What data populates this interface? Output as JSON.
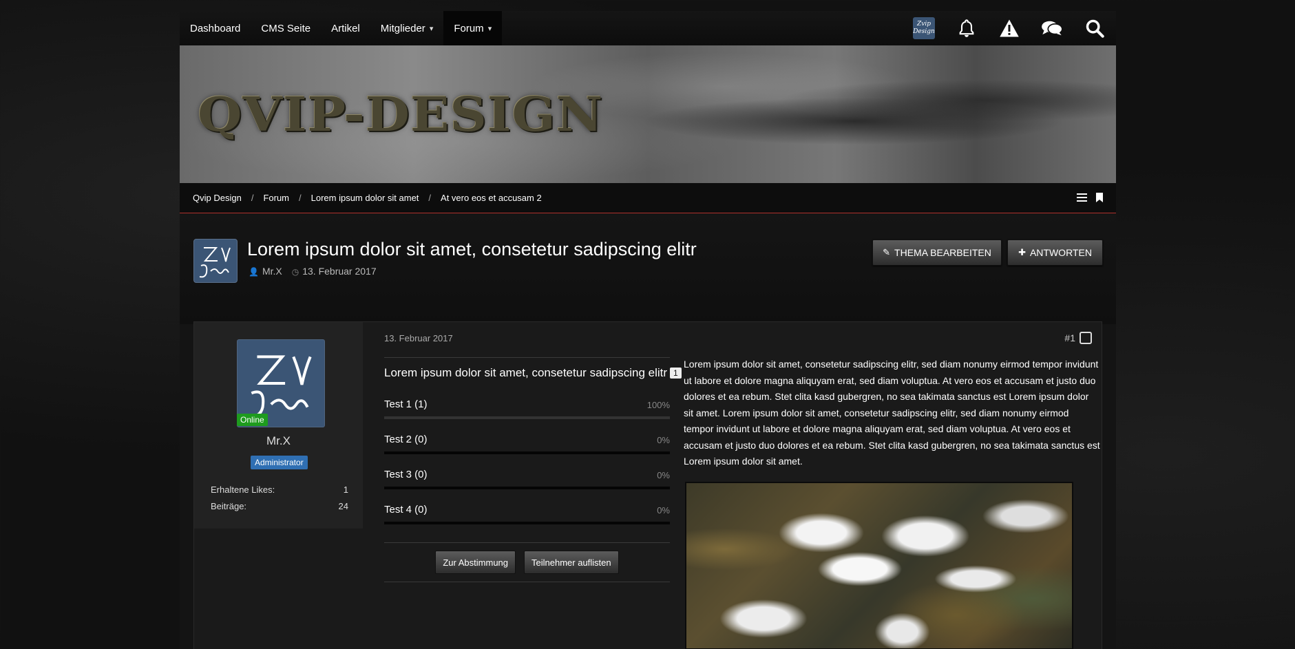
{
  "nav": {
    "items": [
      {
        "label": "Dashboard"
      },
      {
        "label": "CMS Seite"
      },
      {
        "label": "Artikel"
      },
      {
        "label": "Mitglieder",
        "has_dropdown": true
      },
      {
        "label": "Forum",
        "has_dropdown": true,
        "active": true
      }
    ],
    "logo_text_line1": "Zvip",
    "logo_text_line2": "Design",
    "icons": [
      "notifications-icon",
      "warning-icon",
      "conversations-icon",
      "search-icon"
    ]
  },
  "banner": {
    "title": "QVIP-DESIGN"
  },
  "breadcrumb": {
    "items": [
      "Qvip Design",
      "Forum",
      "Lorem ipsum dolor sit amet",
      "At vero eos et accusam 2"
    ],
    "separator": "/"
  },
  "thread": {
    "title": "Lorem ipsum dolor sit amet, consetetur sadipscing elitr",
    "author": "Mr.X",
    "date": "13. Februar 2017",
    "edit_button": "THEMA BEARBEITEN",
    "reply_button": "ANTWORTEN"
  },
  "post": {
    "date": "13. Februar 2017",
    "number": "#1",
    "author": {
      "name": "Mr.X",
      "online_label": "Online",
      "rank": "Administrator",
      "stats": [
        {
          "label": "Erhaltene Likes:",
          "value": "1"
        },
        {
          "label": "Beiträge:",
          "value": "24"
        }
      ]
    },
    "poll": {
      "question": "Lorem ipsum dolor sit amet, consetetur sadipscing elitr",
      "votes": "1",
      "options": [
        {
          "label": "Test 1 (1)",
          "percent": "100%",
          "fraction": 1.0
        },
        {
          "label": "Test 2 (0)",
          "percent": "0%",
          "fraction": 0
        },
        {
          "label": "Test 3 (0)",
          "percent": "0%",
          "fraction": 0
        },
        {
          "label": "Test 4 (0)",
          "percent": "0%",
          "fraction": 0
        }
      ],
      "vote_button": "Zur Abstimmung",
      "participants_button": "Teilnehmer auflisten"
    },
    "text": "Lorem ipsum dolor sit amet, consetetur sadipscing elitr, sed diam nonumy eirmod tempor invidunt ut labore et dolore magna aliquyam erat, sed diam voluptua. At vero eos et accusam et justo duo dolores et ea rebum. Stet clita kasd gubergren, no sea takimata sanctus est Lorem ipsum dolor sit amet. Lorem ipsum dolor sit amet, consetetur sadipscing elitr, sed diam nonumy eirmod tempor invidunt ut labore et dolore magna aliquyam erat, sed diam voluptua. At vero eos et accusam et justo duo dolores et ea rebum. Stet clita kasd gubergren, no sea takimata sanctus est Lorem ipsum dolor sit amet."
  },
  "colors": {
    "accent_red": "#b3322d",
    "online_green": "#1e9b1e",
    "rank_blue": "#2f6fb3",
    "logo_blue": "#3b5575"
  }
}
